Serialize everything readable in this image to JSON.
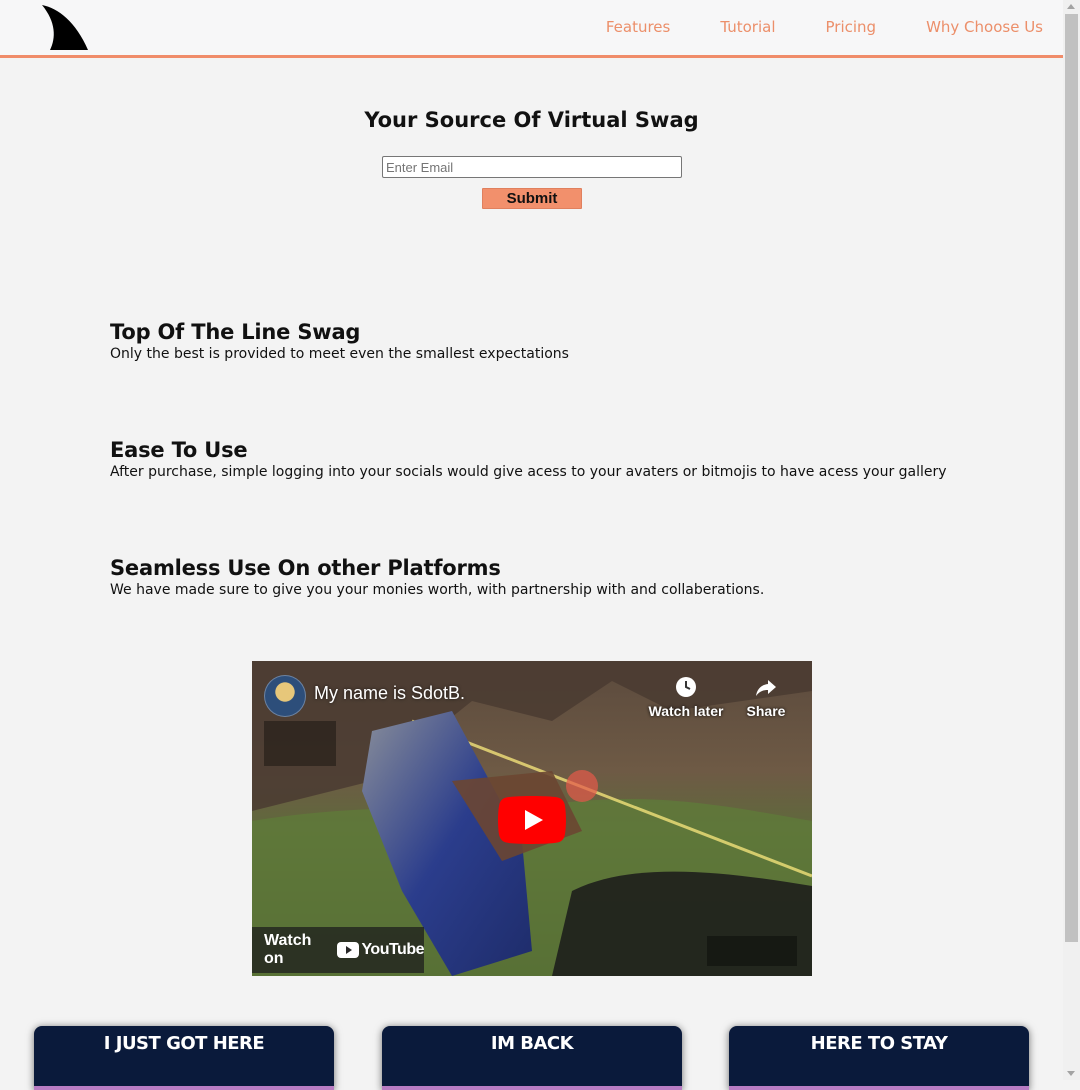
{
  "header": {
    "logo_icon": "shark-fin-icon",
    "nav": [
      "Features",
      "Tutorial",
      "Pricing",
      "Why Choose Us"
    ],
    "accent_color": "#f08c6a"
  },
  "hero": {
    "title": "Your Source Of Virtual Swag",
    "email_placeholder": "Enter Email",
    "email_value": "",
    "submit_label": "Submit"
  },
  "features": [
    {
      "title": "Top Of The Line Swag",
      "text": "Only the best is provided to meet even the smallest expectations"
    },
    {
      "title": "Ease To Use",
      "text": "After purchase, simple logging into your socials would give acess to your avaters or bitmojis to have acess your gallery"
    },
    {
      "title": "Seamless Use On other Platforms",
      "text": "We have made sure to give you your monies worth, with partnership with and collaberations."
    }
  ],
  "video": {
    "title": "My name is SdotB.",
    "watch_later": "Watch later",
    "share": "Share",
    "watch_on": "Watch on",
    "youtube": "YouTube",
    "play_icon": "play-icon"
  },
  "plans": [
    {
      "title": "I JUST GOT HERE"
    },
    {
      "title": "IM BACK"
    },
    {
      "title": "HERE TO STAY"
    }
  ]
}
